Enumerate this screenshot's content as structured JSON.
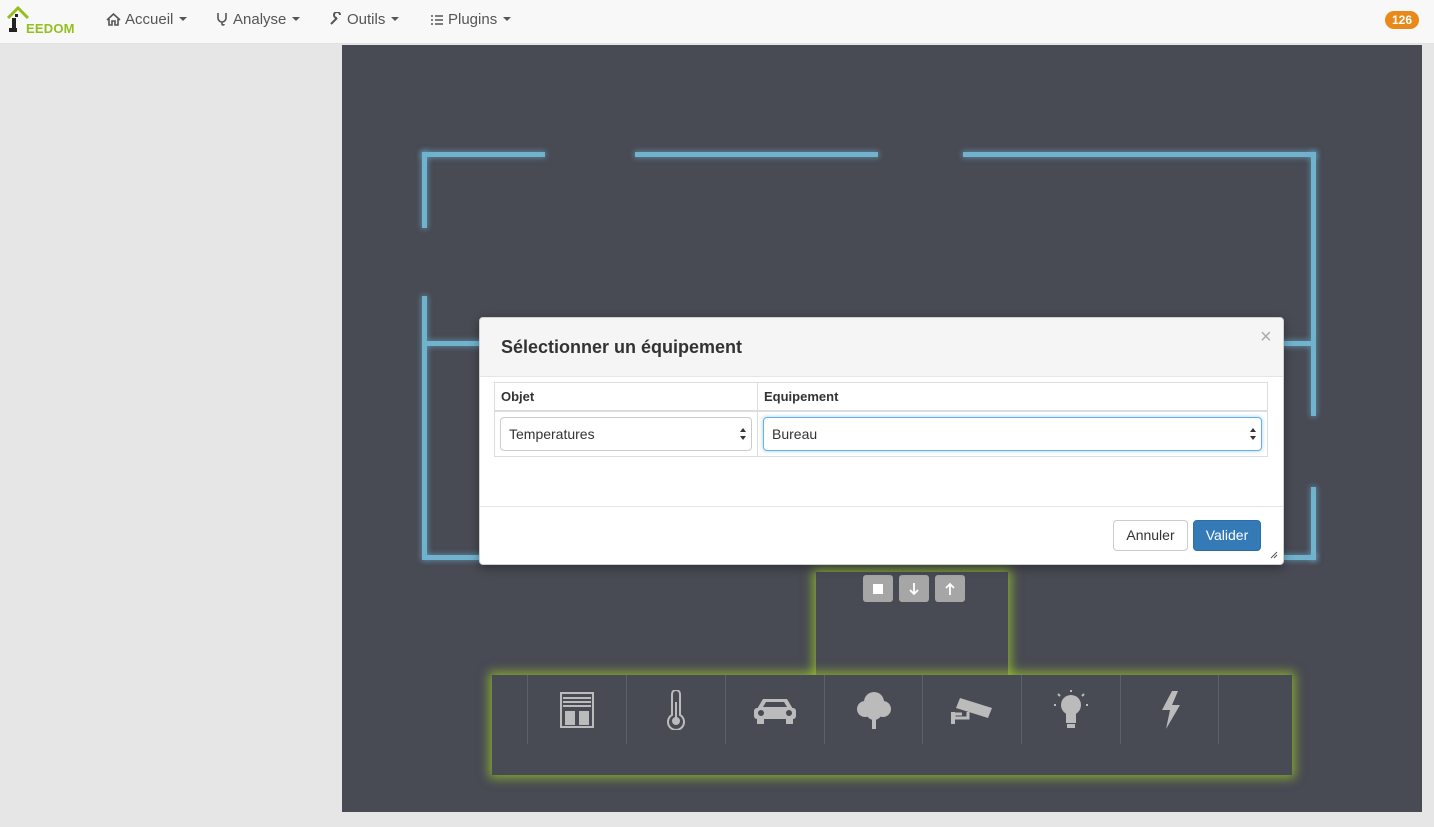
{
  "brand": {
    "name": "EEDOM"
  },
  "nav": {
    "items": [
      {
        "label": "Accueil",
        "icon": "home-icon"
      },
      {
        "label": "Analyse",
        "icon": "stethoscope-icon"
      },
      {
        "label": "Outils",
        "icon": "wrench-icon"
      },
      {
        "label": "Plugins",
        "icon": "tasks-icon"
      }
    ],
    "badge": "126"
  },
  "modal": {
    "title": "Sélectionner un équipement",
    "close": "×",
    "columns": [
      "Objet",
      "Equipement"
    ],
    "objet_value": "Temperatures",
    "equipement_value": "Bureau",
    "cancel_label": "Annuler",
    "confirm_label": "Valider"
  },
  "widget_controls": [
    "square-icon",
    "arrow-down-icon",
    "arrow-up-icon"
  ],
  "toolbar_icons": [
    "shutter-icon",
    "thermometer-icon",
    "car-icon",
    "tree-icon",
    "camera-icon",
    "lightbulb-icon",
    "lightning-icon"
  ],
  "colors": {
    "wall": "#6fb3cf",
    "canvas": "#484a54",
    "highlight": "#9bc828",
    "primary": "#337ab7",
    "badge": "#e8891a"
  }
}
